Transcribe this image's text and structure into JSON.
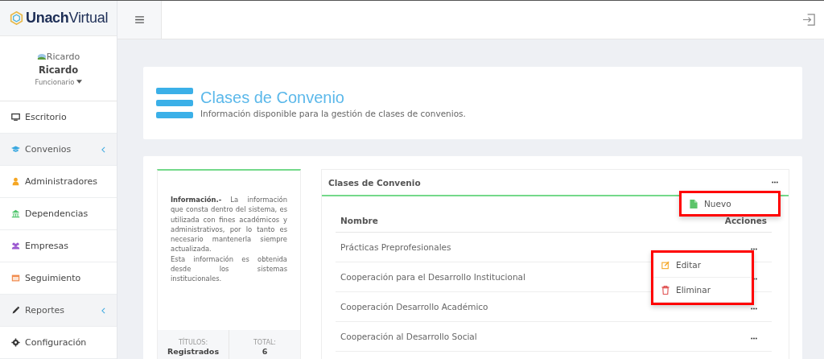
{
  "brand": {
    "bold": "Unach",
    "light": "Virtual"
  },
  "user": {
    "avatar_alt": "Ricardo",
    "name": "Ricardo",
    "role": "Funcionario"
  },
  "sidebar": {
    "items": [
      {
        "label": "Escritorio",
        "expandable": false
      },
      {
        "label": "Convenios",
        "expandable": true
      },
      {
        "label": "Administradores",
        "expandable": false
      },
      {
        "label": "Dependencias",
        "expandable": false
      },
      {
        "label": "Empresas",
        "expandable": false
      },
      {
        "label": "Seguimiento",
        "expandable": false
      },
      {
        "label": "Reportes",
        "expandable": true
      },
      {
        "label": "Configuración",
        "expandable": false
      }
    ]
  },
  "header": {
    "title": "Clases de Convenio",
    "subtitle": "Información disponible para la gestión de clases de convenios."
  },
  "info": {
    "text": "**Información.-** La información que consta dentro del sistema, es utilizada con fines académicos y administrativos, por lo tanto es necesario mantenerla siempre actualizada.",
    "text2": "Esta información es obtenida desde los sistemas institucionales.",
    "stats": [
      {
        "label": "TÍTULOS:",
        "value": "Registrados"
      },
      {
        "label": "TOTAL:",
        "value": "6"
      }
    ]
  },
  "panel": {
    "title": "Clases de Convenio",
    "menu": [
      {
        "label": "Nuevo"
      }
    ],
    "columns": [
      "Nombre",
      "Acciones"
    ],
    "rows": [
      {
        "name": "Prácticas Preprofesionales"
      },
      {
        "name": "Cooperación para el Desarrollo Institucional"
      },
      {
        "name": "Cooperación Desarrollo Académico"
      },
      {
        "name": "Cooperación al Desarrollo Social"
      }
    ],
    "row_menu": [
      {
        "label": "Editar"
      },
      {
        "label": "Eliminar"
      }
    ]
  }
}
